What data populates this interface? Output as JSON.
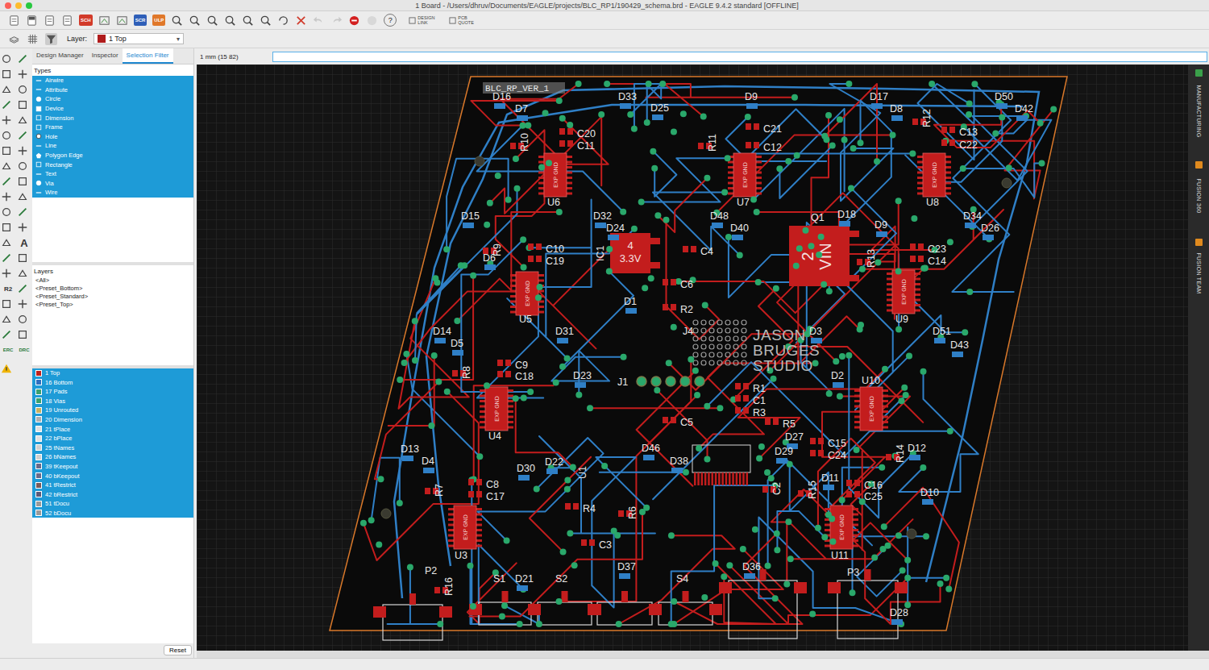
{
  "window": {
    "title": "1 Board - /Users/dhruv/Documents/EAGLE/projects/BLC_RP1/190429_schema.brd - EAGLE 9.4.2 standard [OFFLINE]"
  },
  "toolbar": {
    "badges": [
      {
        "label": "SCH",
        "color": "#d23a2a"
      },
      {
        "label": "SCR",
        "color": "#2f5fb8"
      },
      {
        "label": "ULP",
        "color": "#e0782a"
      }
    ],
    "help": "?",
    "links": [
      "DESIGN LINK",
      "PCB QUOTE"
    ]
  },
  "layer_bar": {
    "label": "Layer:",
    "value": "1 Top",
    "color": "#b01c1c",
    "arrow": "▾"
  },
  "tools": {
    "text_tool": "A",
    "renumber": "R2",
    "erc": "ERC",
    "drc": "DRC"
  },
  "panel": {
    "tabs": [
      {
        "label": "Design Manager",
        "selected": false
      },
      {
        "label": "Inspector",
        "selected": false
      },
      {
        "label": "Selection Filter",
        "selected": true
      }
    ],
    "types_title": "Types",
    "types": [
      {
        "label": "Airwire",
        "selected": true
      },
      {
        "label": "Attribute",
        "selected": true
      },
      {
        "label": "Circle",
        "selected": true
      },
      {
        "label": "Device",
        "selected": true
      },
      {
        "label": "Dimension",
        "selected": true
      },
      {
        "label": "Frame",
        "selected": true
      },
      {
        "label": "Hole",
        "selected": true
      },
      {
        "label": "Line",
        "selected": true
      },
      {
        "label": "Polygon Edge",
        "selected": true
      },
      {
        "label": "Rectangle",
        "selected": true
      },
      {
        "label": "Text",
        "selected": true
      },
      {
        "label": "Via",
        "selected": true
      },
      {
        "label": "Wire",
        "selected": true
      }
    ],
    "layers_title": "Layers",
    "presets": [
      {
        "label": "<All>",
        "selected": false
      },
      {
        "label": "<Preset_Bottom>",
        "selected": false
      },
      {
        "label": "<Preset_Standard>",
        "selected": false
      },
      {
        "label": "<Preset_Top>",
        "selected": false
      }
    ],
    "layers": [
      {
        "label": "1 Top",
        "selected": true,
        "color": "#c0201c"
      },
      {
        "label": "16 Bottom",
        "selected": true,
        "color": "#2f6fc0"
      },
      {
        "label": "17 Pads",
        "selected": true,
        "color": "#3aa070"
      },
      {
        "label": "18 Vias",
        "selected": true,
        "color": "#3aa070"
      },
      {
        "label": "19 Unrouted",
        "selected": true,
        "color": "#c8b060"
      },
      {
        "label": "20 Dimension",
        "selected": true,
        "color": "#b0b0b0"
      },
      {
        "label": "21 tPlace",
        "selected": true,
        "color": "#e0e0e0"
      },
      {
        "label": "22 bPlace",
        "selected": true,
        "color": "#e0e0e0"
      },
      {
        "label": "25 tNames",
        "selected": true,
        "color": "#d0d0d0"
      },
      {
        "label": "26 bNames",
        "selected": true,
        "color": "#d0d0d0"
      },
      {
        "label": "39 tKeepout",
        "selected": true,
        "color": "#6a6a8a"
      },
      {
        "label": "40 bKeepout",
        "selected": true,
        "color": "#6a6a8a"
      },
      {
        "label": "41 tRestrict",
        "selected": true,
        "color": "#7a5a5a"
      },
      {
        "label": "42 bRestrict",
        "selected": true,
        "color": "#5a5a7a"
      },
      {
        "label": "51 tDocu",
        "selected": true,
        "color": "#9a9a9a"
      },
      {
        "label": "52 bDocu",
        "selected": true,
        "color": "#9a9a9a"
      }
    ],
    "reset": "Reset"
  },
  "coord": {
    "reading": "1 mm (15 82)",
    "command": ""
  },
  "right_tabs": [
    {
      "label": "MANUFACTURING",
      "color": "#3aa04a"
    },
    {
      "label": "FUSION 360",
      "color": "#e08a1e"
    },
    {
      "label": "FUSION TEAM",
      "color": "#e08a1e"
    }
  ],
  "board": {
    "title": "BLC_RP_VER_1",
    "logo": [
      "JASON",
      "BRUGES",
      "STUDIO"
    ],
    "regulators": [
      {
        "number": "4",
        "value": "3.3V"
      },
      {
        "number": "2",
        "value": "VIN"
      }
    ],
    "chips": [
      "EXP GND",
      "EXP GND",
      "EXP GND",
      "EXP GND",
      "EXP GND",
      "EXP GND",
      "EXP GND",
      "EXP GND",
      "EXP GND"
    ],
    "labels": [
      "D16",
      "D7",
      "D33",
      "D25",
      "D9",
      "D17",
      "D8",
      "D50",
      "D42",
      "R10",
      "C20",
      "C11",
      "R11",
      "C21",
      "C12",
      "R12",
      "C13",
      "C22",
      "U6",
      "U7",
      "U8",
      "D15",
      "D32",
      "D24",
      "D48",
      "D40",
      "Q1",
      "D18",
      "D9",
      "D34",
      "D26",
      "D6",
      "R9",
      "C10",
      "C19",
      "IC1",
      "C4",
      "R13",
      "C23",
      "C14",
      "C6",
      "D1",
      "R2",
      "U5",
      "U9",
      "D14",
      "D5",
      "D31",
      "J4",
      "D3",
      "D51",
      "D43",
      "R8",
      "C9",
      "C18",
      "D23",
      "D2",
      "U10",
      "J1",
      "R1",
      "C1",
      "R3",
      "C5",
      "R5",
      "D27",
      "U4",
      "D13",
      "D4",
      "D30",
      "D22",
      "U1",
      "D46",
      "D38",
      "D29",
      "C15",
      "C24",
      "R14",
      "D12",
      "D11",
      "C16",
      "C25",
      "D10",
      "C2",
      "R15",
      "R7",
      "C8",
      "C17",
      "R4",
      "R6",
      "C3",
      "U3",
      "U11",
      "P2",
      "R16",
      "S1",
      "D21",
      "S2",
      "D37",
      "S4",
      "D36",
      "P3",
      "D28"
    ]
  }
}
